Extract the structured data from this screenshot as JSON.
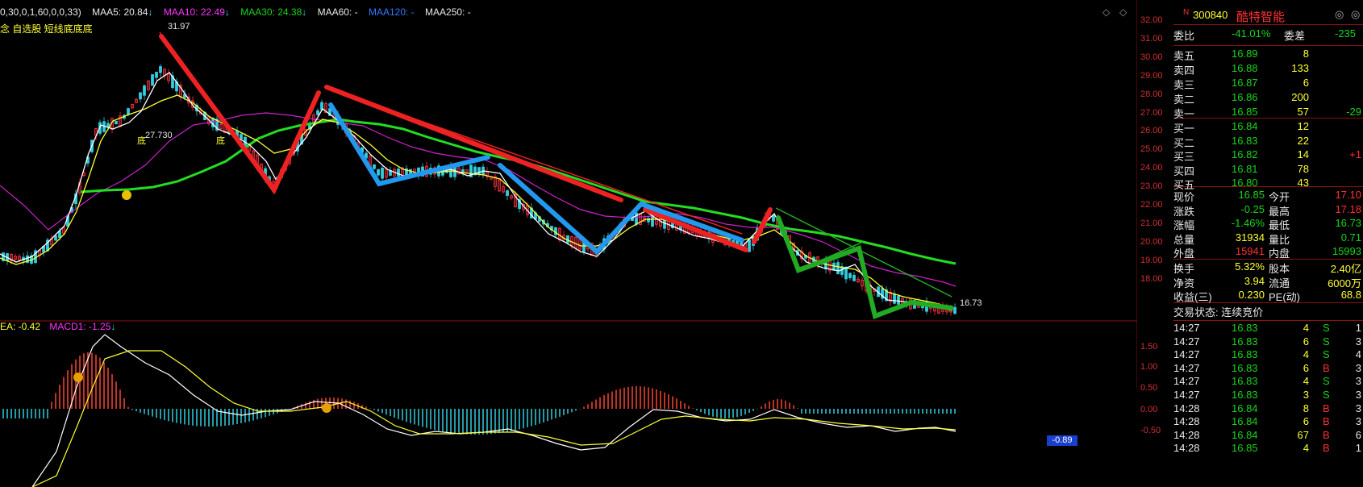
{
  "chart_header": {
    "params": "0,30,0,1,60,0,0,33)",
    "ma5": "MAA5: 20.84",
    "ma10": "MAA10: 22.49",
    "ma30": "MAA30: 24.38",
    "ma60": "MAA60: -",
    "ma120": "MAA120: -",
    "ma250": "MAA250: -",
    "arrow": "↓"
  },
  "chart_sub_header": "念 自选股 短线底底底",
  "price_axis": [
    "32.00",
    "31.00",
    "30.00",
    "29.00",
    "28.00",
    "27.00",
    "26.00",
    "25.00",
    "24.00",
    "23.00",
    "22.00",
    "21.00",
    "20.00",
    "19.00",
    "18.00"
  ],
  "price_annotations": {
    "high": "31.97",
    "mid": "27.730",
    "current": "16.73",
    "di1": "底",
    "di2": "底"
  },
  "macd_header": {
    "dea": "EA: -0.42",
    "macd": "MACD1: -1.25",
    "arrow": "↓"
  },
  "macd_axis": [
    "1.50",
    "1.00",
    "0.50",
    "0.00",
    "-0.50"
  ],
  "macd_current": "-0.89",
  "stock": {
    "code": "300840",
    "name": "酷特智能",
    "flag": "N"
  },
  "ratio": {
    "label": "委比",
    "value": "-41.01%",
    "diff_label": "委差",
    "diff_value": "-235"
  },
  "asks": [
    {
      "label": "卖五",
      "price": "16.89",
      "vol": "8",
      "chg": ""
    },
    {
      "label": "卖四",
      "price": "16.88",
      "vol": "133",
      "chg": ""
    },
    {
      "label": "卖三",
      "price": "16.87",
      "vol": "6",
      "chg": ""
    },
    {
      "label": "卖二",
      "price": "16.86",
      "vol": "200",
      "chg": ""
    },
    {
      "label": "卖一",
      "price": "16.85",
      "vol": "57",
      "chg": "-29"
    }
  ],
  "bids": [
    {
      "label": "买一",
      "price": "16.84",
      "vol": "12",
      "chg": ""
    },
    {
      "label": "买二",
      "price": "16.83",
      "vol": "22",
      "chg": ""
    },
    {
      "label": "买三",
      "price": "16.82",
      "vol": "14",
      "chg": "+1"
    },
    {
      "label": "买四",
      "price": "16.81",
      "vol": "78",
      "chg": ""
    },
    {
      "label": "买五",
      "price": "16.80",
      "vol": "43",
      "chg": ""
    }
  ],
  "quote": [
    {
      "l1": "现价",
      "v1": "16.85",
      "l2": "今开",
      "v2": "17.10"
    },
    {
      "l1": "涨跌",
      "v1": "-0.25",
      "l2": "最高",
      "v2": "17.18"
    },
    {
      "l1": "涨幅",
      "v1": "-1.46%",
      "l2": "最低",
      "v2": "16.73"
    },
    {
      "l1": "总量",
      "v1": "31934",
      "l2": "量比",
      "v2": "0.71"
    },
    {
      "l1": "外盘",
      "v1": "15941",
      "l2": "内盘",
      "v2": "15993"
    }
  ],
  "fundamentals": [
    {
      "l1": "换手",
      "v1": "5.32%",
      "l2": "股本",
      "v2": "2.40亿"
    },
    {
      "l1": "净资",
      "v1": "3.94",
      "l2": "流通",
      "v2": "6000万"
    },
    {
      "l1": "收益(三)",
      "v1": "0.230",
      "l2": "PE(动)",
      "v2": "68.8"
    }
  ],
  "trade_status": "交易状态: 连续竞价",
  "ticks": [
    {
      "time": "14:27",
      "price": "16.83",
      "vol": "4",
      "side": "S",
      "n": "1"
    },
    {
      "time": "14:27",
      "price": "16.83",
      "vol": "6",
      "side": "S",
      "n": "3"
    },
    {
      "time": "14:27",
      "price": "16.83",
      "vol": "4",
      "side": "S",
      "n": "4"
    },
    {
      "time": "14:27",
      "price": "16.83",
      "vol": "6",
      "side": "B",
      "n": "3"
    },
    {
      "time": "14:27",
      "price": "16.83",
      "vol": "4",
      "side": "S",
      "n": "3"
    },
    {
      "time": "14:27",
      "price": "16.83",
      "vol": "3",
      "side": "S",
      "n": "3"
    },
    {
      "time": "14:28",
      "price": "16.84",
      "vol": "8",
      "side": "B",
      "n": "3"
    },
    {
      "time": "14:28",
      "price": "16.84",
      "vol": "6",
      "side": "B",
      "n": "3"
    },
    {
      "time": "14:28",
      "price": "16.84",
      "vol": "67",
      "side": "B",
      "n": "6"
    },
    {
      "time": "14:28",
      "price": "16.85",
      "vol": "4",
      "side": "B",
      "n": "1"
    }
  ],
  "colors": {
    "up": "#ff3030",
    "down": "#19d419",
    "ma5": "#ffffff",
    "ma10": "#ffff33",
    "ma30": "#ff33ff",
    "ma60": "#22dd22",
    "annot_red": "#ee2222",
    "annot_blue": "#2299ee",
    "annot_green": "#22aa22"
  }
}
